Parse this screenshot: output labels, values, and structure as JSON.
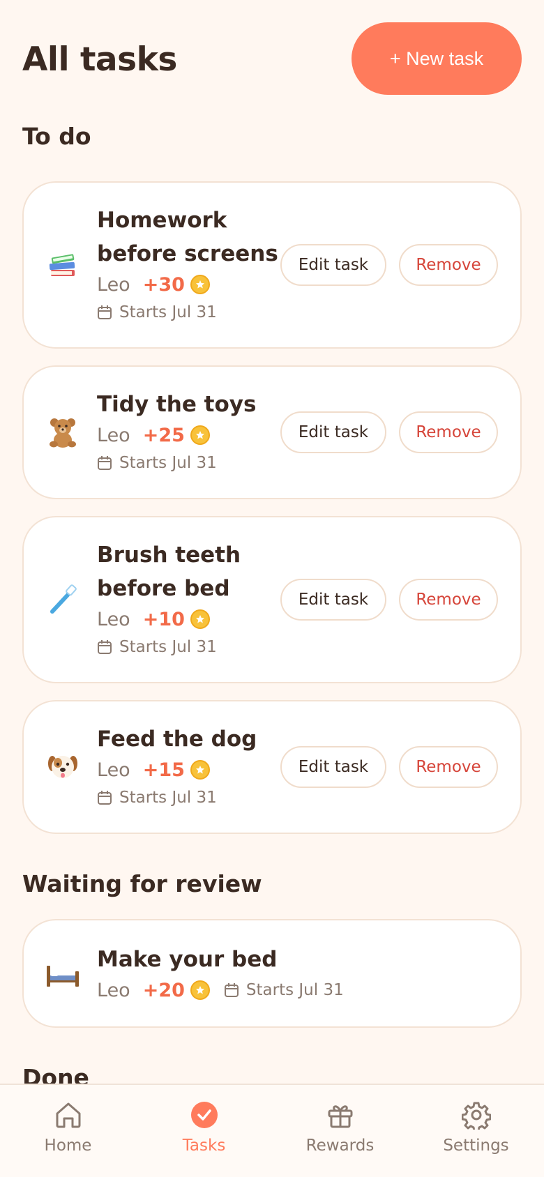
{
  "header": {
    "title": "All tasks",
    "new_task_label": "+ New task"
  },
  "sections": {
    "todo": "To do",
    "review": "Waiting for review",
    "done": "Done"
  },
  "todo_tasks": [
    {
      "title_line1": "Homework",
      "title_line2": "before screens",
      "kid": "Leo",
      "points": "+30",
      "date": "Starts Jul 31",
      "icon": "books-icon"
    },
    {
      "title_line1": "Tidy the toys",
      "kid": "Leo",
      "points": "+25",
      "date": "Starts Jul 31",
      "icon": "teddy-bear-icon"
    },
    {
      "title_line1": "Brush teeth",
      "title_line2": "before bed",
      "kid": "Leo",
      "points": "+10",
      "date": "Starts Jul 31",
      "icon": "toothbrush-icon"
    },
    {
      "title_line1": "Feed the dog",
      "kid": "Leo",
      "points": "+15",
      "date": "Starts Jul 31",
      "icon": "dog-face-icon"
    }
  ],
  "review_tasks": [
    {
      "title": "Make your bed",
      "kid": "Leo",
      "points": "+20",
      "date": "Starts Jul 31",
      "icon": "bed-icon"
    }
  ],
  "actions": {
    "edit_label": "Edit task",
    "remove_label": "Remove"
  },
  "nav": {
    "items": [
      {
        "label": "Home",
        "icon": "home-icon",
        "active": false
      },
      {
        "label": "Tasks",
        "icon": "check-circle-icon",
        "active": true
      },
      {
        "label": "Rewards",
        "icon": "gift-icon",
        "active": false
      },
      {
        "label": "Settings",
        "icon": "gear-icon",
        "active": false
      }
    ]
  },
  "colors": {
    "accent": "#ff7b5c",
    "danger": "#d6453a",
    "background": "#fff7f1",
    "coin": "#f8c23a"
  }
}
